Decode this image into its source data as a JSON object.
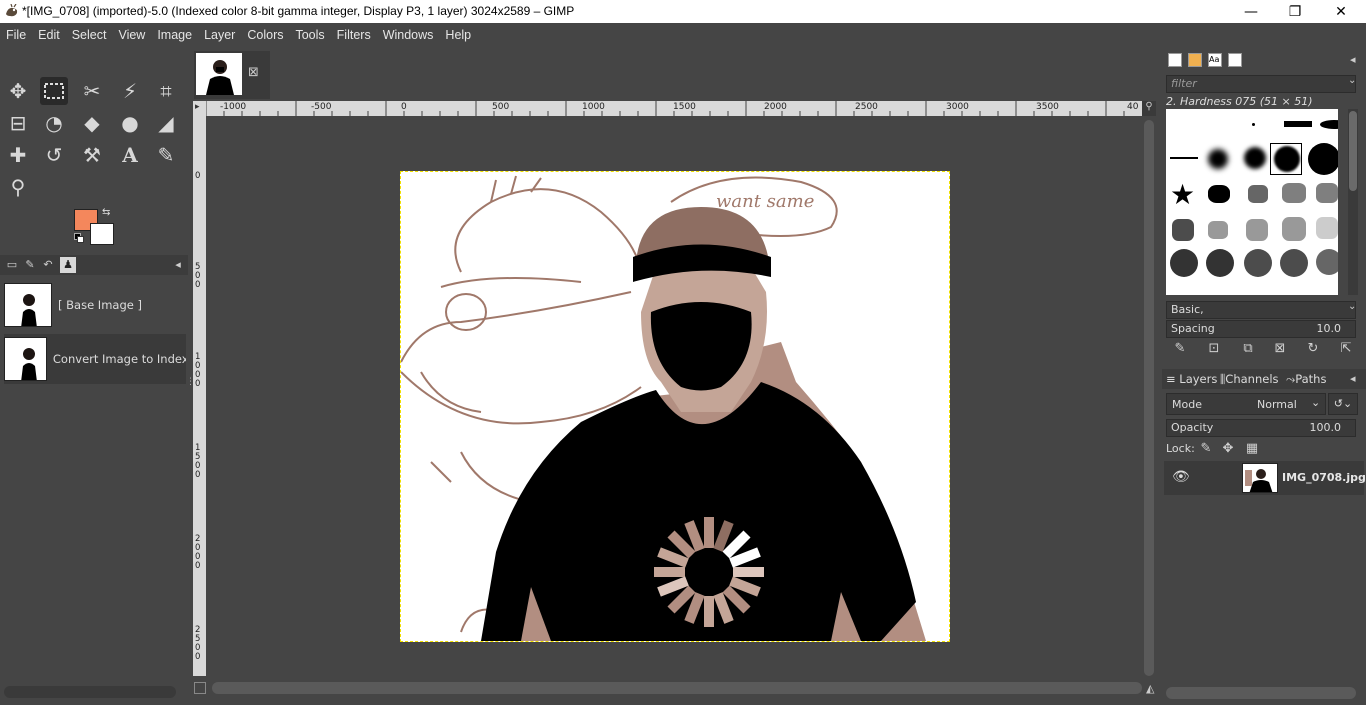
{
  "window": {
    "title": "*[IMG_0708] (imported)-5.0 (Indexed color 8-bit gamma integer, Display P3, 1 layer) 3024x2589 – GIMP",
    "minimize": "—",
    "maximize": "❐",
    "close": "✕"
  },
  "menu": [
    "File",
    "Edit",
    "Select",
    "View",
    "Image",
    "Layer",
    "Colors",
    "Tools",
    "Filters",
    "Windows",
    "Help"
  ],
  "colors": {
    "foreground": "#f4875c",
    "background": "#ffffff",
    "accent_canvas_border": "#f0e000"
  },
  "tools": [
    "move-tool-icon",
    "rect-select-tool-icon",
    "scissors-tool-icon",
    "fuzzy-select-tool-icon",
    "crop-tool-icon",
    "align-tool-icon",
    "warp-tool-icon",
    "bucket-fill-tool-icon",
    "smudge-tool-icon",
    "eraser-tool-icon",
    "heal-tool-icon",
    "paths-tool-icon",
    "clone-tool-icon",
    "text-tool-icon",
    "color-picker-tool-icon",
    "zoom-tool-icon"
  ],
  "undo_history": {
    "items": [
      {
        "label": "[ Base Image ]"
      },
      {
        "label": "Convert Image to Indexed"
      }
    ]
  },
  "image_tab": {
    "close": "⊠"
  },
  "ruler_h": [
    "-1000",
    "-500",
    "0",
    "500",
    "1000",
    "1500",
    "2000",
    "2500",
    "3000",
    "3500",
    "40"
  ],
  "ruler_v": [
    "0",
    "5\n0\n0",
    "1\n0\n0\n0",
    "1\n5\n0\n0",
    "2\n0\n0\n0",
    "2\n5\n0\n0"
  ],
  "brushes": {
    "filter_placeholder": "filter",
    "current": "2. Hardness 075 (51 × 51)",
    "tag": "Basic,",
    "spacing_label": "Spacing",
    "spacing_value": "10.0"
  },
  "layers": {
    "tabs": [
      "Layers",
      "Channels",
      "Paths"
    ],
    "mode_label": "Mode",
    "mode_value": "Normal",
    "opacity_label": "Opacity",
    "opacity_value": "100.0",
    "lock_label": "Lock:",
    "items": [
      {
        "name": "IMG_0708.jpg"
      }
    ]
  },
  "image_doodle_text": "want same"
}
